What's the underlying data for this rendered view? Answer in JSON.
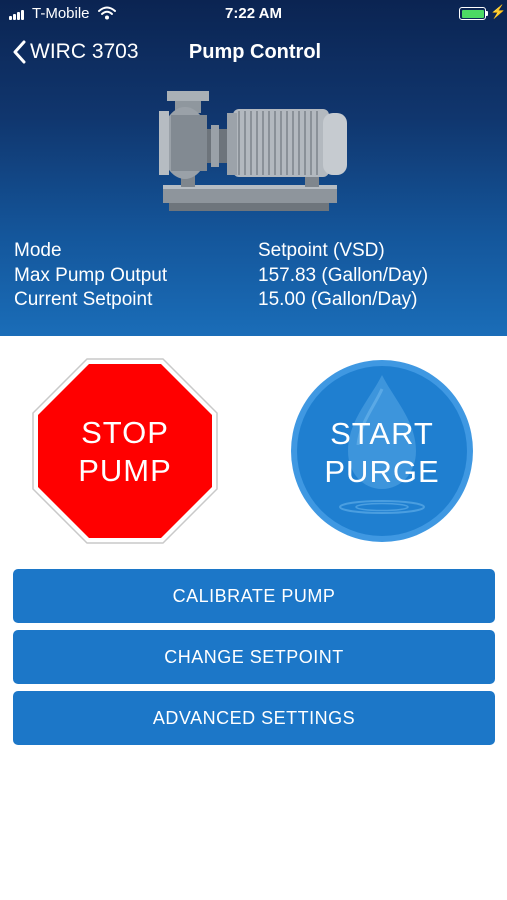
{
  "status_bar": {
    "carrier": "T-Mobile",
    "time": "7:22 AM",
    "battery_color": "#4cd964"
  },
  "nav": {
    "back_label": "WIRC 3703",
    "title": "Pump Control"
  },
  "info": [
    {
      "label": "Mode",
      "value": "Setpoint (VSD)"
    },
    {
      "label": "Max Pump Output",
      "value": "157.83 (Gallon/Day)"
    },
    {
      "label": "Current Setpoint",
      "value": "15.00 (Gallon/Day)"
    }
  ],
  "controls": {
    "stop_line1": "STOP",
    "stop_line2": "PUMP",
    "stop_color": "#ff0000",
    "purge_line1": "START",
    "purge_line2": "PURGE",
    "purge_color": "#1f7fd0"
  },
  "actions": {
    "calibrate": "CALIBRATE PUMP",
    "setpoint": "CHANGE SETPOINT",
    "advanced": "ADVANCED SETTINGS"
  },
  "icons": [
    "signal-icon",
    "wifi-icon",
    "battery-icon",
    "charging-icon",
    "back-chevron-icon",
    "pump-illustration",
    "water-drop-icon"
  ]
}
